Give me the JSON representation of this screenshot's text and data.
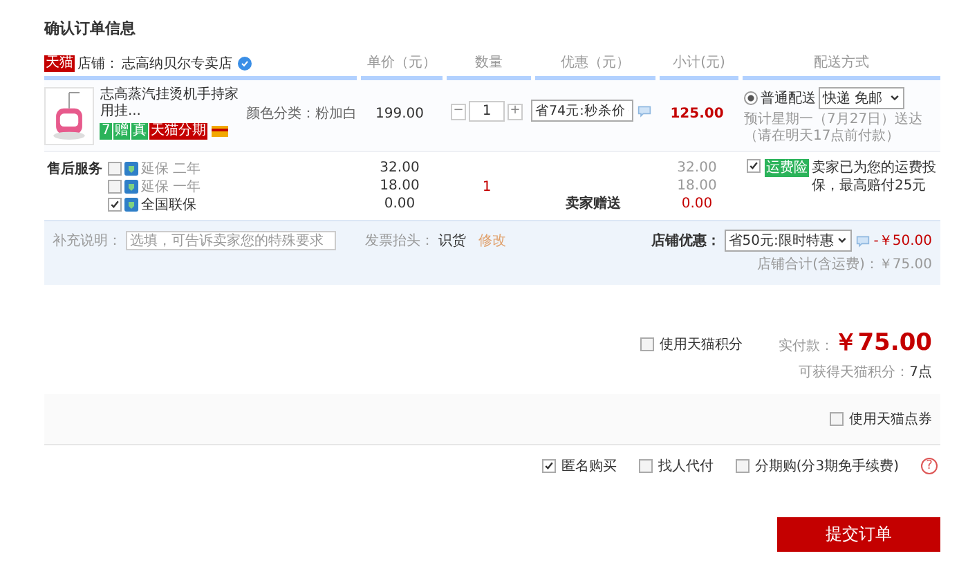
{
  "title": "确认订单信息",
  "shop": {
    "badge": "天猫",
    "label": "店铺：",
    "name": "志高纳贝尔专卖店"
  },
  "columns": [
    "单价（元）",
    "数量",
    "优惠（元）",
    "小计(元)",
    "配送方式"
  ],
  "item": {
    "name": "志高蒸汽挂烫机手持家用挂...",
    "badges": [
      {
        "text": "7",
        "color": "#2bb35a"
      },
      {
        "text": "赠",
        "color": "#2bb35a"
      },
      {
        "text": "真",
        "color": "#2bb35a"
      },
      {
        "text": "天猫分期",
        "color": "#c40000"
      }
    ],
    "spec": "颜色分类：粉加白",
    "price": "199.00",
    "minus": "−",
    "quantity": "1",
    "plus": "+",
    "discount": "省74元:秒杀价",
    "subtotal": "125.00",
    "delivery": {
      "option": "普通配送",
      "selected": true,
      "method": "快递 免邮",
      "estimate": "预计星期一（7月27日）送达",
      "note": "（请在明天17点前付款）"
    }
  },
  "services": {
    "label": "售后服务",
    "options": [
      {
        "name": "延保 二年",
        "checked": false,
        "price": "32.00",
        "subtotal": "32.00"
      },
      {
        "name": "延保 一年",
        "checked": false,
        "price": "18.00",
        "subtotal": "18.00"
      },
      {
        "name": "全国联保",
        "checked": true,
        "price": "0.00",
        "subtotal": "0.00"
      }
    ],
    "quantity": "1",
    "gift": "卖家赠送",
    "insurance": {
      "checked": true,
      "badge": "运费险",
      "text": "卖家已为您的运费投保，最高赔付25元"
    }
  },
  "shop_footer": {
    "note_label": "补充说明：",
    "note_placeholder": "选填，可告诉卖家您的特殊要求",
    "invoice_label": "发票抬头：",
    "invoice_value": "识货",
    "invoice_edit": "修改",
    "promo_label": "店铺优惠：",
    "promo": "省50元:限时特惠",
    "promo_amount": "-￥50.00",
    "total": "店铺合计(含运费)：￥75.00"
  },
  "summary": {
    "points_option": {
      "label": "使用天猫积分",
      "checked": false
    },
    "pay_label": "实付款：",
    "pay_amount": "￥75.00",
    "earn_label": "可获得天猫积分：",
    "earn_value": "7点"
  },
  "coupon_option": {
    "label": "使用天猫点券",
    "checked": false
  },
  "options": [
    {
      "label": "匿名购买",
      "checked": true
    },
    {
      "label": "找人代付",
      "checked": false
    },
    {
      "label": "分期购(分3期免手续费)",
      "checked": false
    }
  ],
  "help": "?",
  "submit": "提交订单"
}
